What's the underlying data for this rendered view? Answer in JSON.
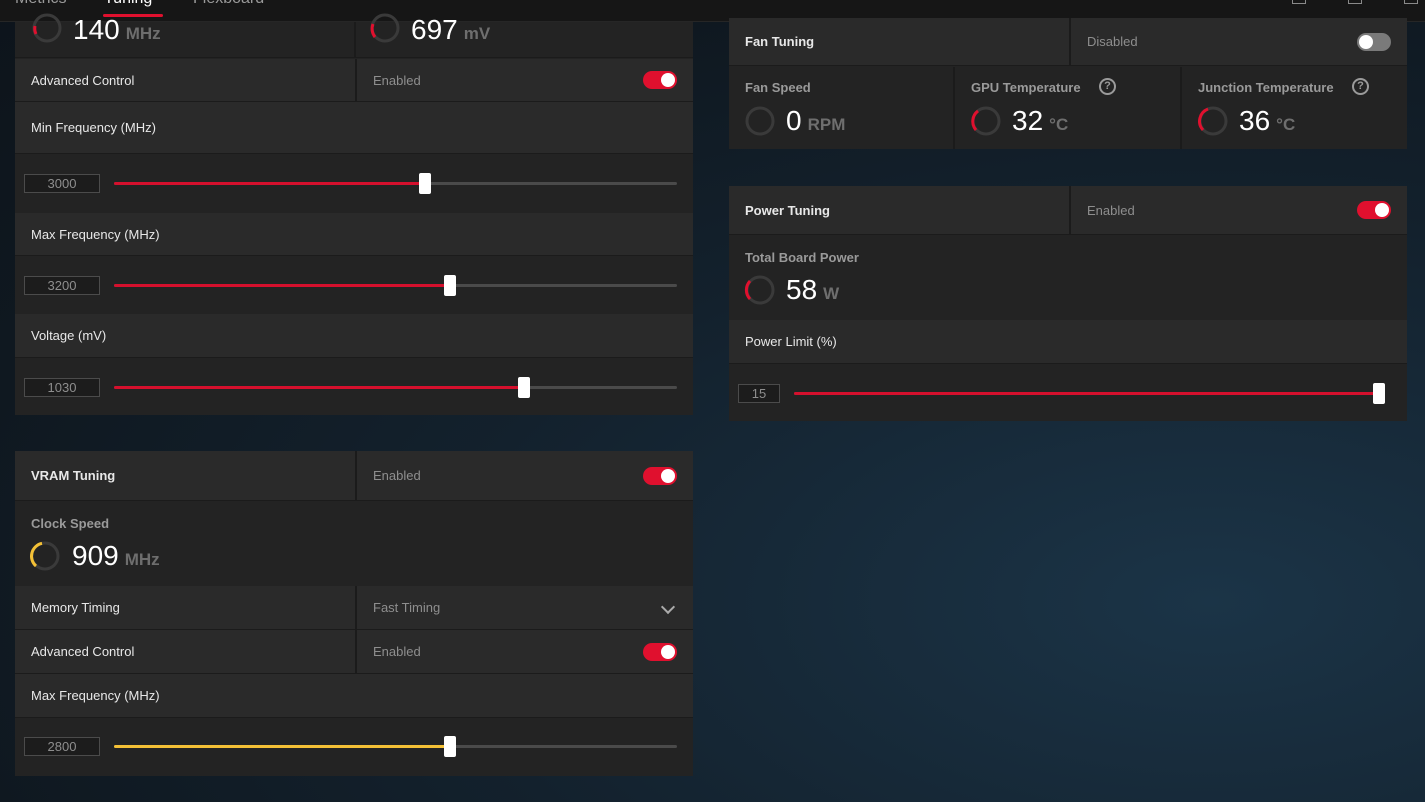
{
  "nav": {
    "tabs": [
      "Metrics",
      "Tuning",
      "Flexboard"
    ],
    "active": "Tuning"
  },
  "gpu": {
    "clock_value": "140",
    "clock_unit": "MHz",
    "voltage_value": "697",
    "voltage_unit": "mV",
    "advanced_control_label": "Advanced Control",
    "advanced_control_state": "Enabled",
    "min_freq_label": "Min Frequency (MHz)",
    "min_freq_value": "3000",
    "min_freq_fraction": 0.553,
    "max_freq_label": "Max Frequency (MHz)",
    "max_freq_value": "3200",
    "max_freq_fraction": 0.597,
    "voltage_label": "Voltage (mV)",
    "voltage_slider_value": "1030",
    "voltage_fraction": 0.729
  },
  "vram": {
    "title": "VRAM Tuning",
    "state": "Enabled",
    "clock_label": "Clock Speed",
    "clock_value": "909",
    "clock_unit": "MHz",
    "memory_timing_label": "Memory Timing",
    "memory_timing_value": "Fast Timing",
    "advanced_control_label": "Advanced Control",
    "advanced_control_state": "Enabled",
    "max_freq_label": "Max Frequency (MHz)",
    "max_freq_value": "2800",
    "max_freq_fraction": 0.597
  },
  "fan": {
    "title": "Fan Tuning",
    "state": "Disabled",
    "speed_label": "Fan Speed",
    "speed_value": "0",
    "speed_unit": "RPM",
    "gpu_temp_label": "GPU Temperature",
    "gpu_temp_value": "32",
    "gpu_temp_unit": "°C",
    "junction_temp_label": "Junction Temperature",
    "junction_temp_value": "36",
    "junction_temp_unit": "°C",
    "help_glyph": "?"
  },
  "power": {
    "title": "Power Tuning",
    "state": "Enabled",
    "board_power_label": "Total Board Power",
    "board_power_value": "58",
    "board_power_unit": "W",
    "limit_label": "Power Limit (%)",
    "limit_value": "15",
    "limit_fraction": 1.0
  },
  "colors": {
    "accent_red": "#e0102e",
    "accent_yellow": "#f3c036"
  }
}
